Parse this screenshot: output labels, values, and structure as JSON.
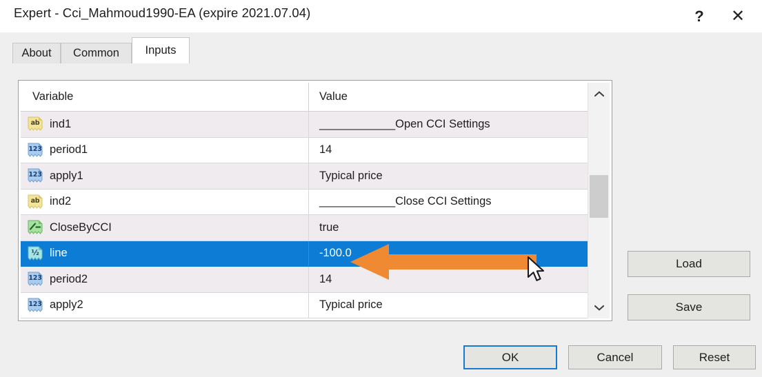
{
  "window": {
    "title": "Expert - Cci_Mahmoud1990-EA (expire 2021.07.04)",
    "help_label": "?",
    "close_label": "✕"
  },
  "tabs": [
    {
      "label": "About",
      "active": false
    },
    {
      "label": "Common",
      "active": false
    },
    {
      "label": "Inputs",
      "active": true
    }
  ],
  "table": {
    "columns": {
      "variable": "Variable",
      "value": "Value"
    },
    "rows": [
      {
        "icon": "string-type-icon",
        "glyph": "ab",
        "variable": "ind1",
        "value": "____________Open CCI Settings",
        "selected": false
      },
      {
        "icon": "integer-type-icon",
        "glyph": "123",
        "variable": "period1",
        "value": "14",
        "selected": false
      },
      {
        "icon": "integer-type-icon",
        "glyph": "123",
        "variable": "apply1",
        "value": "Typical price",
        "selected": false
      },
      {
        "icon": "string-type-icon",
        "glyph": "ab",
        "variable": "ind2",
        "value": "____________Close CCI Settings",
        "selected": false
      },
      {
        "icon": "bool-type-icon",
        "glyph": "",
        "variable": "CloseByCCI",
        "value": "true",
        "selected": false
      },
      {
        "icon": "double-type-icon",
        "glyph": "½",
        "variable": "line",
        "value": "-100.0",
        "selected": true
      },
      {
        "icon": "integer-type-icon",
        "glyph": "123",
        "variable": "period2",
        "value": "14",
        "selected": false
      },
      {
        "icon": "integer-type-icon",
        "glyph": "123",
        "variable": "apply2",
        "value": "Typical price",
        "selected": false
      }
    ]
  },
  "side_buttons": {
    "load": "Load",
    "save": "Save"
  },
  "footer_buttons": {
    "ok": "OK",
    "cancel": "Cancel",
    "reset": "Reset"
  },
  "scrollbar": {
    "up": "⌃",
    "down": "⌄"
  },
  "colors": {
    "selection_blue": "#0c7cd5",
    "focus_blue": "#1679d0",
    "annotation_orange": "#F08A32",
    "row_alt": "#f0ebef",
    "dialog_bg": "#efefef"
  }
}
